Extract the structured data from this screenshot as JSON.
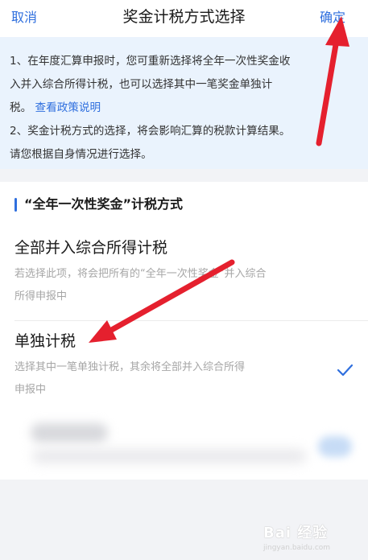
{
  "header": {
    "cancel_label": "取消",
    "title": "奖金计税方式选择",
    "confirm_label": "确定"
  },
  "notice": {
    "line1": "1、在年度汇算申报时，您可重新选择将全年一次性奖金收",
    "line2": "入并入综合所得计税，也可以选择其中一笔奖金单独计",
    "line3_prefix": "税。",
    "policy_link": "查看政策说明",
    "line4": "2、奖金计税方式的选择，将会影响汇算的税款计算结果。",
    "line5": "请您根据自身情况进行选择。"
  },
  "section": {
    "title": "“全年一次性奖金”计税方式"
  },
  "options": [
    {
      "name": "全部并入综合所得计税",
      "desc_line1": "若选择此项，将会把所有的“全年一次性奖金”并入综合",
      "desc_line2": "所得申报中",
      "selected": false
    },
    {
      "name": "单独计税",
      "desc_line1": "选择其中一笔单独计税，其余将全部并入综合所得",
      "desc_line2": "申报中",
      "selected": true
    }
  ],
  "watermark": {
    "text": "Bai 经验",
    "sub": "jingyan.baidu.com"
  },
  "colors": {
    "accent": "#2f6fde",
    "annotation_arrow": "#e5202e",
    "notice_bg": "#eaf3fd"
  }
}
